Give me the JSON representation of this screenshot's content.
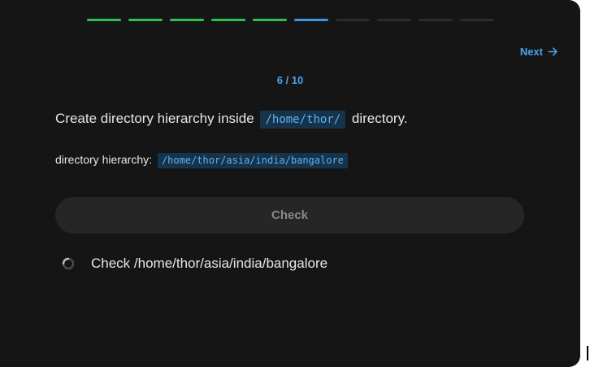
{
  "progress": {
    "total": 10,
    "current": 6,
    "segments": [
      "complete",
      "complete",
      "complete",
      "complete",
      "complete",
      "current",
      "pending",
      "pending",
      "pending",
      "pending"
    ],
    "colors": {
      "complete": "#2fbf4f",
      "current": "#3a95e8",
      "pending": "#2c2c2c"
    }
  },
  "nav": {
    "next_label": "Next",
    "next_icon": "arrow-right-icon"
  },
  "counter": "6 / 10",
  "question": {
    "prefix": "Create directory hierarchy inside",
    "code": "/home/thor/",
    "suffix": "directory."
  },
  "hierarchy": {
    "label": "directory hierarchy:",
    "code": "/home/thor/asia/india/bangalore"
  },
  "check_button": {
    "label": "Check"
  },
  "tasks": [
    {
      "label": "Check /home/thor/asia/india/bangalore",
      "status_icon": "loading-spinner-icon"
    }
  ]
}
